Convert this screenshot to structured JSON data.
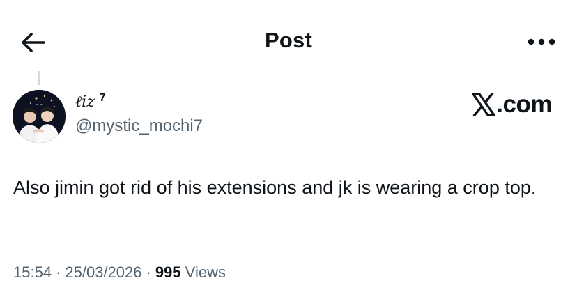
{
  "header": {
    "title": "Post",
    "back_icon": "arrow-left-icon",
    "more_icon": "more-horizontal-icon"
  },
  "author": {
    "display_name": "ℓiz",
    "display_name_suffix": "7",
    "handle": "@mystic_mochi7",
    "avatar": "profile-photo"
  },
  "watermark": {
    "text": ".com",
    "logo": "x-logo-icon"
  },
  "post": {
    "text": "Also jimin got rid of his extensions and jk is wearing a crop top."
  },
  "meta": {
    "time": "15:54",
    "date": "25/03/2026",
    "views_count": "995",
    "views_label": "Views"
  },
  "colors": {
    "text_primary": "#0f1419",
    "text_secondary": "#536471",
    "thread_line": "#cfd9de"
  }
}
